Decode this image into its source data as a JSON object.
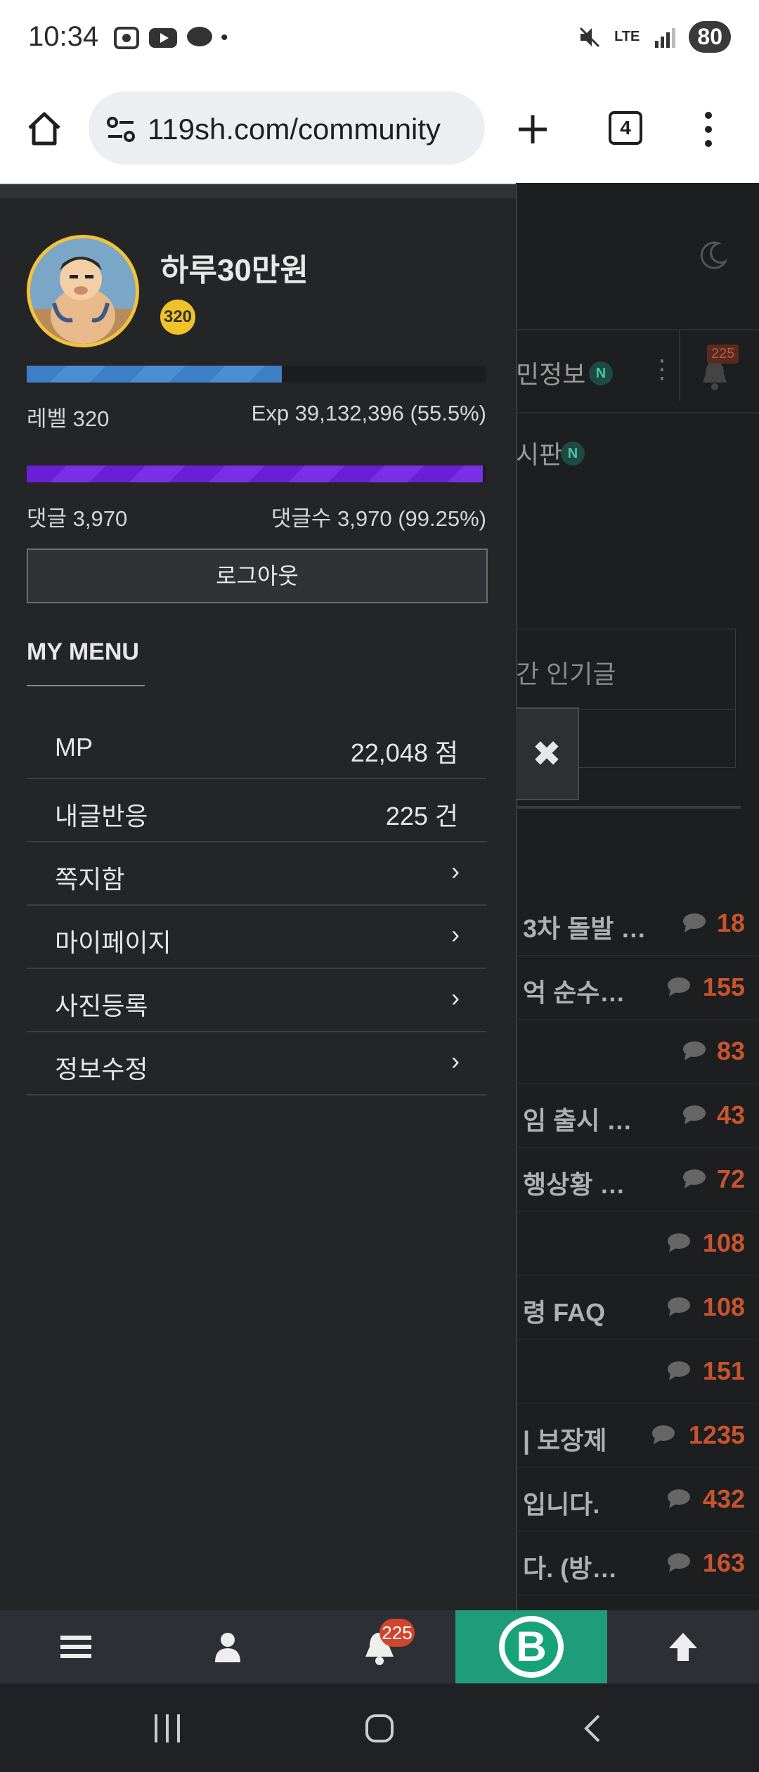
{
  "status_bar": {
    "time": "10:34",
    "battery": "80",
    "network": "LTE"
  },
  "browser": {
    "url": "119sh.com/community",
    "tab_count": "4"
  },
  "background_page": {
    "nav_item_1": "민정보",
    "nav_item_2": "시판",
    "new_badge": "N",
    "header_badge": "225",
    "popular_label": "간 인기글",
    "posts": [
      {
        "title": "3차 돌발 …",
        "count": "18"
      },
      {
        "title": "억 순수…",
        "count": "155"
      },
      {
        "title": "",
        "count": "83"
      },
      {
        "title": "임 출시 …",
        "count": "43"
      },
      {
        "title": "행상황 …",
        "count": "72"
      },
      {
        "title": "",
        "count": "108"
      },
      {
        "title": "령 FAQ",
        "count": "108"
      },
      {
        "title": "",
        "count": "151"
      },
      {
        "title": "| 보장제",
        "count": "1235"
      },
      {
        "title": "입니다.",
        "count": "432"
      },
      {
        "title": "다. (방…",
        "count": "163"
      }
    ]
  },
  "drawer": {
    "username": "하루30만원",
    "level_badge": "320",
    "level_label": "레벨 320",
    "exp_label": "Exp 39,132,396 (55.5%)",
    "exp_fraction": 0.555,
    "comment_label": "댓글 3,970",
    "comment_count_label": "댓글수 3,970 (99.25%)",
    "comment_fraction": 0.9925,
    "logout_label": "로그아웃",
    "menu_title": "MY MENU",
    "menu": [
      {
        "label": "MP",
        "value": "22,048 점"
      },
      {
        "label": "내글반응",
        "value": "225 건"
      },
      {
        "label": "쪽지함",
        "value": "›"
      },
      {
        "label": "마이페이지",
        "value": "›"
      },
      {
        "label": "사진등록",
        "value": "›"
      },
      {
        "label": "정보수정",
        "value": "›"
      }
    ],
    "close_label": "✖"
  },
  "bottom_nav": {
    "notification_badge": "225",
    "b_label": "B"
  }
}
